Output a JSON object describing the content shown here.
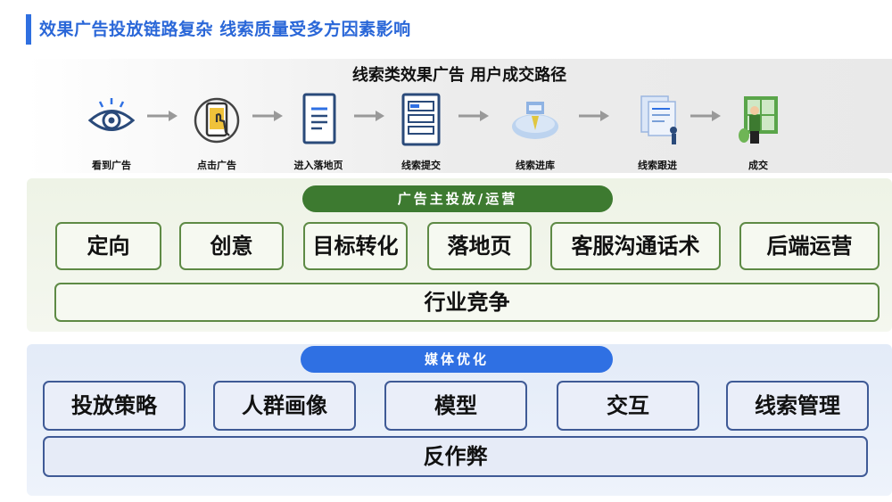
{
  "header": {
    "title": "效果广告投放链路复杂 线索质量受多方因素影响"
  },
  "flow": {
    "title": "线索类效果广告  用户成交路径",
    "steps": [
      {
        "label": "看到广告",
        "icon": "eye-icon"
      },
      {
        "label": "点击广告",
        "icon": "tap-phone-icon"
      },
      {
        "label": "进入落地页",
        "icon": "document-icon"
      },
      {
        "label": "线索提交",
        "icon": "form-icon"
      },
      {
        "label": "线索进库",
        "icon": "database-icon"
      },
      {
        "label": "线索跟进",
        "icon": "data-analysis-icon"
      },
      {
        "label": "成交",
        "icon": "deal-person-icon"
      }
    ]
  },
  "advertiser": {
    "header": "广告主投放/运营",
    "items": [
      "定向",
      "创意",
      "目标转化",
      "落地页",
      "客服沟通话术",
      "后端运营"
    ],
    "wide": "行业竞争"
  },
  "media": {
    "header": "媒体优化",
    "items": [
      "投放策略",
      "人群画像",
      "模型",
      "交互",
      "线索管理"
    ],
    "wide": "反作弊"
  },
  "colors": {
    "accent": "#2a67d8",
    "green": "#3d7a30",
    "blue": "#2f70e3"
  }
}
